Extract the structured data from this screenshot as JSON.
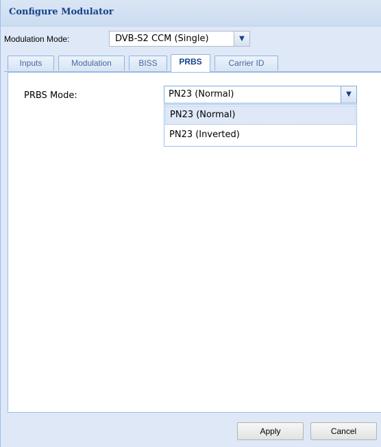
{
  "dialog": {
    "title": "Configure Modulator"
  },
  "modulation": {
    "label": "Modulation Mode:",
    "value": "DVB-S2 CCM (Single)"
  },
  "tabs": [
    {
      "label": "Inputs"
    },
    {
      "label": "Modulation"
    },
    {
      "label": "BISS"
    },
    {
      "label": "PRBS",
      "active": true
    },
    {
      "label": "Carrier ID"
    }
  ],
  "prbs": {
    "label": "PRBS Mode:",
    "value": "PN23 (Normal)",
    "options": [
      "PN23 (Normal)",
      "PN23 (Inverted)"
    ]
  },
  "buttons": {
    "apply": "Apply",
    "cancel": "Cancel"
  },
  "colors": {
    "title": "#15428b",
    "frame": "#dfe8f6",
    "border": "#99bbe8"
  }
}
